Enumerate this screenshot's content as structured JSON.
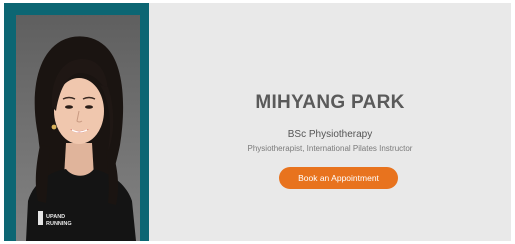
{
  "profile": {
    "name": "MIHYANG PARK",
    "degree": "BSc Physiotherapy",
    "role": "Physiotherapist, International Pilates Instructor",
    "book_label": "Book an Appointment",
    "shirt_logo_line1": "UPAND",
    "shirt_logo_line2": "RUNNING"
  },
  "colors": {
    "frame": "#0c6673",
    "panel": "#e9e9e9",
    "button": "#e8731e"
  },
  "icons": {
    "portrait": "portrait-photo"
  }
}
